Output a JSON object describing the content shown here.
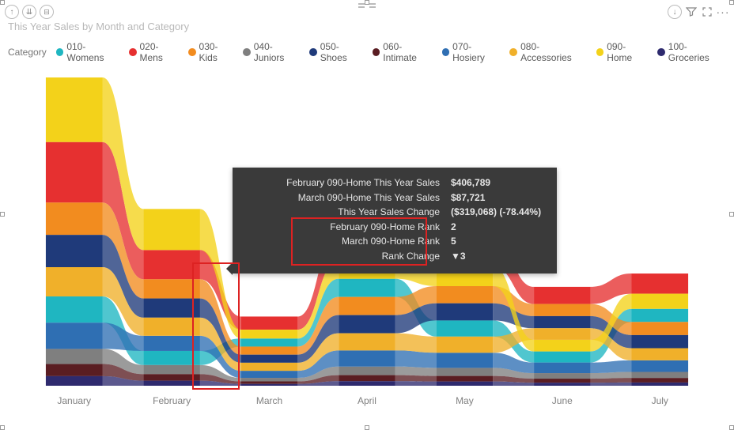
{
  "title": "This Year Sales by Month and Category",
  "toolbar": {
    "drill_up": "↑",
    "drill_down_all": "↓↓",
    "drill_hierarchy": "⬚",
    "export": "⇩",
    "filter": "⧩",
    "focus": "⛶",
    "more": "···"
  },
  "legend": {
    "label": "Category",
    "items": [
      {
        "name": "010-Womens",
        "color": "#1fb6c1"
      },
      {
        "name": "020-Mens",
        "color": "#e63030"
      },
      {
        "name": "030-Kids",
        "color": "#f28c1f"
      },
      {
        "name": "040-Juniors",
        "color": "#7f7f7f"
      },
      {
        "name": "050-Shoes",
        "color": "#1f3a7a"
      },
      {
        "name": "060-Intimate",
        "color": "#5a1d22"
      },
      {
        "name": "070-Hosiery",
        "color": "#2f6fb3"
      },
      {
        "name": "080-Accessories",
        "color": "#f0b02a"
      },
      {
        "name": "090-Home",
        "color": "#f3d21a"
      },
      {
        "name": "100-Groceries",
        "color": "#2e2a6e"
      }
    ]
  },
  "tooltip": {
    "rows": [
      {
        "label": "February 090-Home This Year Sales",
        "value": "$406,789"
      },
      {
        "label": "March 090-Home This Year Sales",
        "value": "$87,721"
      },
      {
        "label": "This Year Sales Change",
        "value": "($319,068) (-78.44%)"
      },
      {
        "label": "February 090-Home Rank",
        "value": "2"
      },
      {
        "label": "March 090-Home Rank",
        "value": "5"
      },
      {
        "label": "Rank Change",
        "value": "▼3"
      }
    ]
  },
  "chart_data": {
    "type": "area",
    "title": "This Year Sales by Month and Category",
    "xlabel": "",
    "ylabel": "",
    "categories": [
      "January",
      "February",
      "March",
      "April",
      "May",
      "June",
      "July"
    ],
    "series": [
      {
        "name": "010-Womens",
        "color": "#1fb6c1",
        "values": [
          260000,
          140000,
          80000,
          180000,
          160000,
          110000,
          130000
        ]
      },
      {
        "name": "020-Mens",
        "color": "#e63030",
        "values": [
          600000,
          290000,
          130000,
          270000,
          260000,
          170000,
          200000
        ]
      },
      {
        "name": "030-Kids",
        "color": "#f28c1f",
        "values": [
          320000,
          190000,
          80000,
          180000,
          170000,
          120000,
          130000
        ]
      },
      {
        "name": "040-Juniors",
        "color": "#7f7f7f",
        "values": [
          150000,
          90000,
          35000,
          85000,
          80000,
          55000,
          60000
        ]
      },
      {
        "name": "050-Shoes",
        "color": "#1f3a7a",
        "values": [
          320000,
          190000,
          80000,
          180000,
          170000,
          120000,
          130000
        ]
      },
      {
        "name": "060-Intimate",
        "color": "#5a1d22",
        "values": [
          120000,
          65000,
          25000,
          60000,
          55000,
          40000,
          45000
        ]
      },
      {
        "name": "070-Hosiery",
        "color": "#2f6fb3",
        "values": [
          260000,
          150000,
          70000,
          160000,
          150000,
          105000,
          115000
        ]
      },
      {
        "name": "080-Accessories",
        "color": "#f0b02a",
        "values": [
          290000,
          180000,
          80000,
          170000,
          160000,
          115000,
          120000
        ]
      },
      {
        "name": "090-Home",
        "color": "#f3d21a",
        "values": [
          640000,
          406789,
          87721,
          190000,
          195000,
          115000,
          150000
        ]
      },
      {
        "name": "100-Groceries",
        "color": "#2e2a6e",
        "values": [
          95000,
          50000,
          18000,
          45000,
          42000,
          30000,
          32000
        ]
      }
    ],
    "highlight": {
      "from": "February",
      "to": "March",
      "series": "090-Home"
    }
  }
}
